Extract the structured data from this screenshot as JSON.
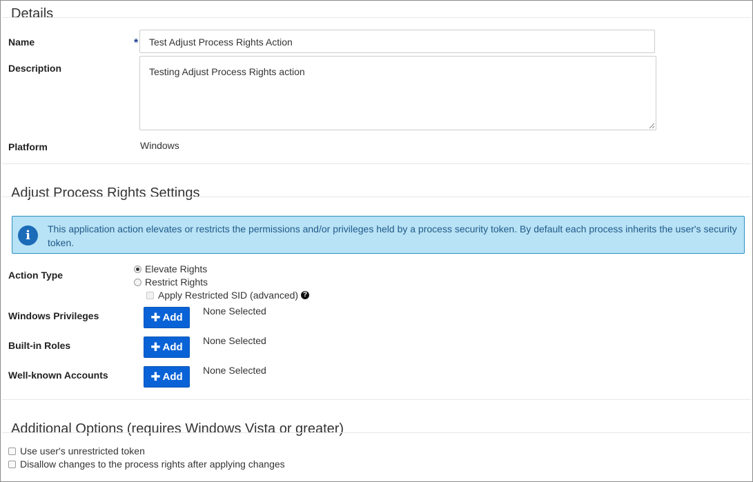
{
  "details": {
    "title": "Details",
    "name_label": "Name",
    "required_marker": "*",
    "name_value": "Test Adjust Process Rights Action",
    "description_label": "Description",
    "description_value": "Testing Adjust Process Rights action",
    "platform_label": "Platform",
    "platform_value": "Windows"
  },
  "settings": {
    "title": "Adjust Process Rights Settings",
    "info_icon": "i",
    "info_text": "This application action elevates or restricts the permissions and/or privileges held by a process security token. By default each process inherits the user's security token.",
    "action_type_label": "Action Type",
    "elevate_label": "Elevate Rights",
    "restrict_label": "Restrict Rights",
    "restricted_sid_label": "Apply Restricted SID (advanced)",
    "help_glyph": "?",
    "windows_privileges_label": "Windows Privileges",
    "builtin_roles_label": "Built-in Roles",
    "wellknown_accounts_label": "Well-known Accounts",
    "add_label": "Add",
    "none_selected": "None Selected"
  },
  "additional": {
    "title": "Additional Options (requires Windows Vista or greater)",
    "unrestricted_token_label": "Use user's unrestricted token",
    "disallow_changes_label": "Disallow changes to the process rights after applying changes"
  },
  "colors": {
    "info_bg": "#b8e2f5",
    "info_border": "#2a8fc2",
    "button_blue": "#0a63d6",
    "required_star": "#1a3d8f"
  }
}
